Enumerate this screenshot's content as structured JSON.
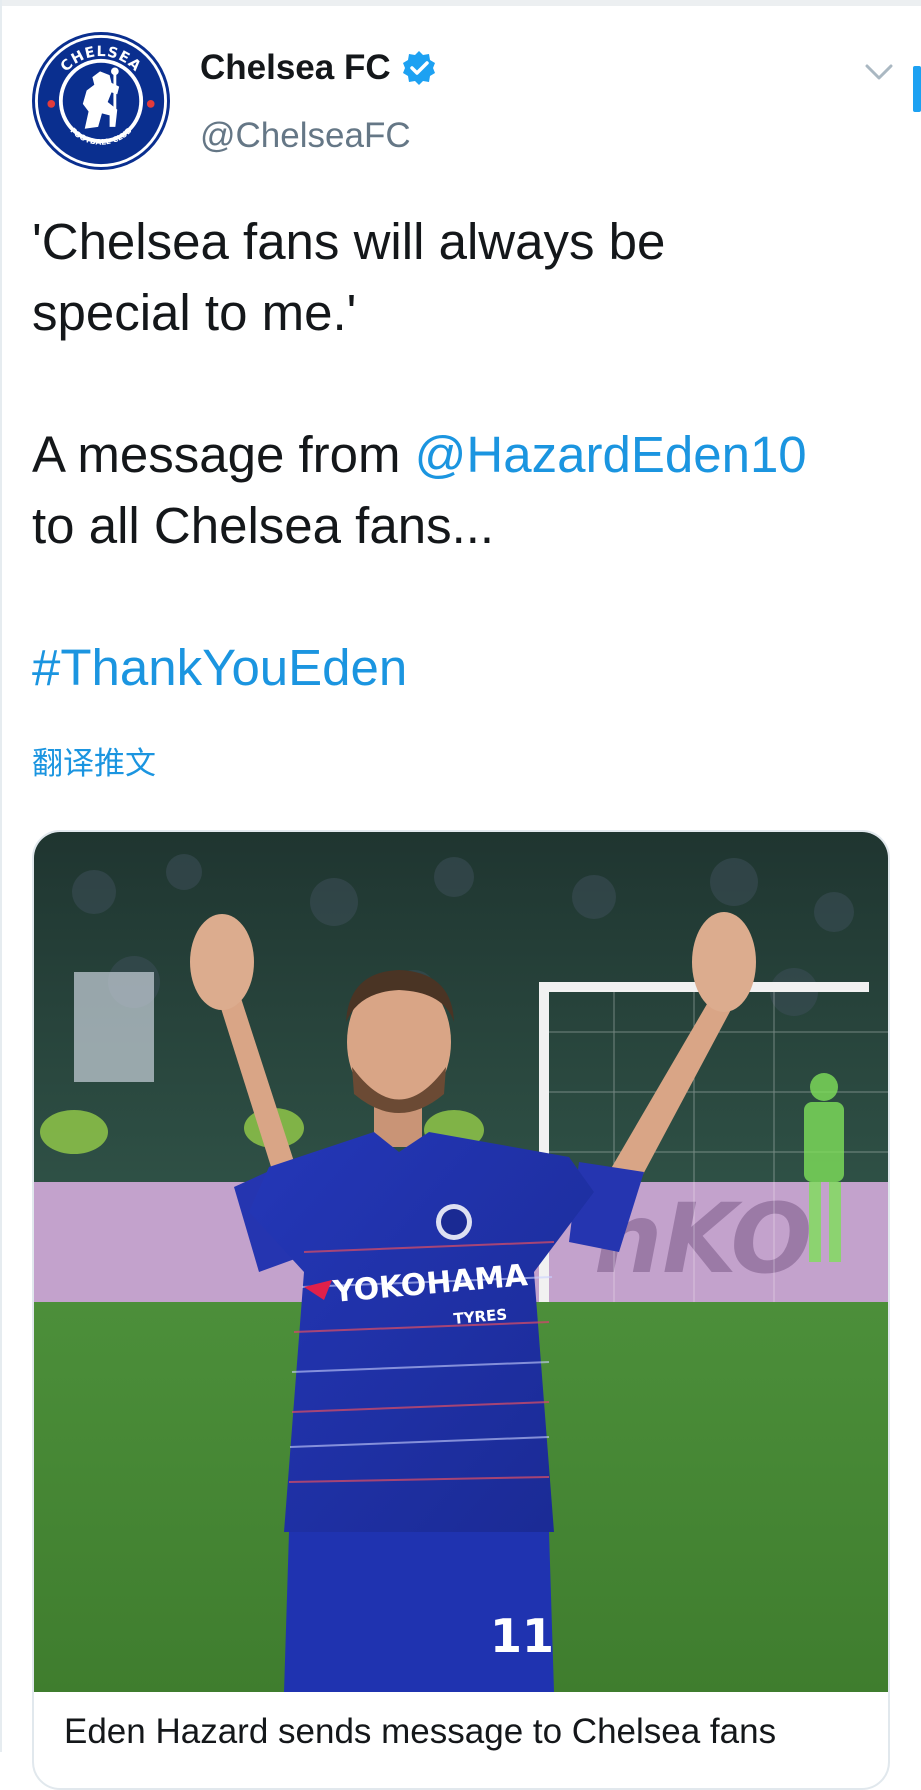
{
  "tweet": {
    "author": {
      "display_name": "Chelsea FC",
      "handle": "@ChelseaFC",
      "verified": true,
      "avatar_icon": "chelsea-crest-icon",
      "avatar_text_top": "CHELSEA",
      "avatar_text_bottom": "FOOTBALL CLUB"
    },
    "text": {
      "line1": "'Chelsea fans will always be",
      "line2": "special to me.'",
      "line3_prefix": "A message from ",
      "mention": "@HazardEden10",
      "line4": "to all Chelsea fans...",
      "hashtag": "#ThankYouEden"
    },
    "translate_label": "翻译推文",
    "media": {
      "shirt_sponsor": "YOKOHAMA",
      "shirt_sponsor_sub": "TYRES",
      "shirt_number": "11",
      "banner_text": "nKO",
      "card_title": "Eden Hazard sends message to Chelsea fans"
    }
  },
  "colors": {
    "link": "#1b95e0",
    "verified_badge": "#1da1f2",
    "handle_gray": "#657786",
    "chelsea_blue": "#0a2f8f"
  }
}
